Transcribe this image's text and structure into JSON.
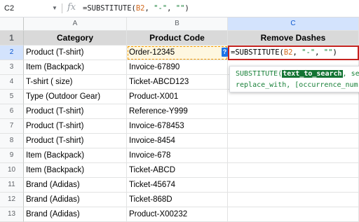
{
  "formula_bar": {
    "name_box": "C2",
    "fx_icon": "fx",
    "formula_prefix": "=SUBSTITUTE(",
    "formula_ref": "B2",
    "formula_sep1": ", ",
    "formula_str1": "\"-\"",
    "formula_sep2": ", ",
    "formula_str2": "\"\"",
    "formula_suffix": ")"
  },
  "columns": [
    "A",
    "B",
    "C"
  ],
  "header_row": {
    "num": "1",
    "a": "Category",
    "b": "Product Code",
    "c": "Remove Dashes"
  },
  "rows": [
    {
      "num": "2",
      "a": "Product (T-shirt)",
      "b": "Order-12345"
    },
    {
      "num": "3",
      "a": "Item (Backpack)",
      "b": "Invoice-67890"
    },
    {
      "num": "4",
      "a": "T-shirt ( size)",
      "b": "Ticket-ABCD123"
    },
    {
      "num": "5",
      "a": "Type (Outdoor Gear)",
      "b": "Product-X001"
    },
    {
      "num": "6",
      "a": "Product (T-shirt)",
      "b": "Reference-Y999"
    },
    {
      "num": "7",
      "a": "Product (T-shirt)",
      "b": "Invoice-678453"
    },
    {
      "num": "8",
      "a": "Product (T-shirt)",
      "b": "Invoice-8454"
    },
    {
      "num": "9",
      "a": "Item (Backpack)",
      "b": "Invoice-678"
    },
    {
      "num": "10",
      "a": "Item (Backpack)",
      "b": "Ticket-ABCD"
    },
    {
      "num": "11",
      "a": "Brand (Adidas)",
      "b": "Ticket-45674"
    },
    {
      "num": "12",
      "a": "Brand (Adidas)",
      "b": "Ticket-868D"
    },
    {
      "num": "13",
      "a": "Brand (Adidas)",
      "b": "Product-X00232"
    }
  ],
  "active_cell": {
    "prefix": "=SUBSTITUTE(",
    "ref": "B2",
    "sep1": ", ",
    "str1": "\"-\"",
    "sep2": ", ",
    "str2": "\"\"",
    "suffix": ")"
  },
  "help_badge": "?",
  "popup": {
    "fn_name": "SUBSTITUTE(",
    "arg1": "text_to_search",
    "rest1": ", se",
    "line2": "replace_with, [occurrence_num"
  },
  "colors": {
    "accent": "#1a73e8",
    "header_fill": "#d9d9d9",
    "active_border": "#c5221f",
    "ref_dash": "#f29900"
  }
}
